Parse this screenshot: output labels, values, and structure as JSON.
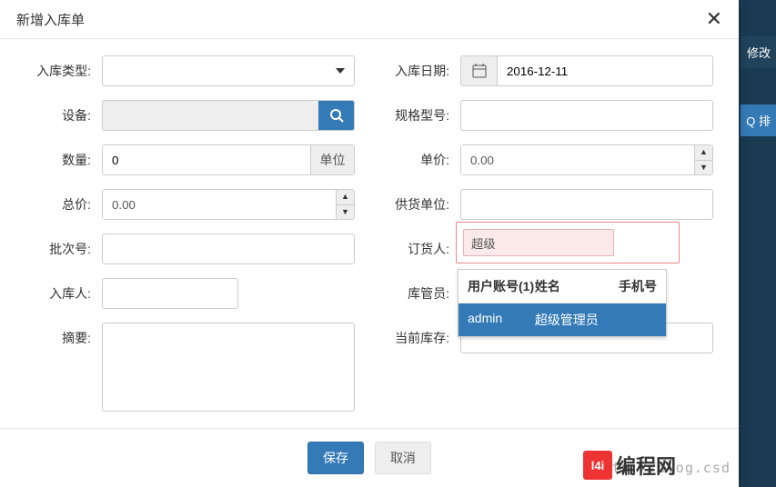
{
  "modal": {
    "title": "新增入库单",
    "labels": {
      "type": "入库类型:",
      "date": "入库日期:",
      "device": "设备:",
      "spec": "规格型号:",
      "quantity": "数量:",
      "unitprice": "单价:",
      "total": "总价:",
      "supplier": "供货单位:",
      "batch": "批次号:",
      "orderer": "订货人:",
      "warehouser": "入库人:",
      "keeper": "库管员:",
      "summary": "摘要:",
      "stock": "当前库存:"
    },
    "values": {
      "date": "2016-12-11",
      "quantity": "0",
      "unit_addon": "单位",
      "unitprice": "0.00",
      "total": "0.00",
      "orderer": "超级"
    },
    "autocomplete": {
      "col_account": "用户账号(1)",
      "col_name": "姓名",
      "col_phone": "手机号",
      "row_account": "admin",
      "row_name": "超级管理员",
      "row_phone": ""
    },
    "buttons": {
      "save": "保存",
      "cancel": "取消"
    }
  },
  "background": {
    "btn1": "修改",
    "btn2": "Q 排"
  },
  "watermark": "http://blog.csd",
  "logo": {
    "badge": "l4i",
    "text": "编程网"
  }
}
